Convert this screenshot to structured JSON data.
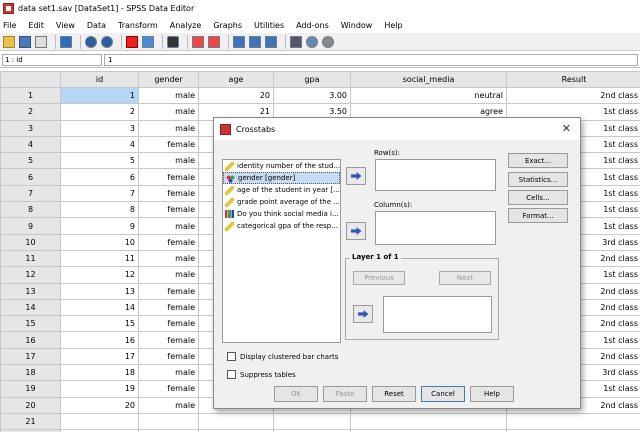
{
  "window": {
    "title": "data set1.sav [DataSet1] - SPSS Data Editor"
  },
  "menu": [
    "File",
    "Edit",
    "View",
    "Data",
    "Transform",
    "Analyze",
    "Graphs",
    "Utilities",
    "Add-ons",
    "Window",
    "Help"
  ],
  "toolbar": {
    "icons": [
      "open-folder-icon",
      "save-icon",
      "print-icon",
      "dialog-recall-icon",
      "undo-icon",
      "redo-icon",
      "go-to-case-icon",
      "variables-icon",
      "find-icon",
      "insert-cases-icon",
      "insert-variable-icon",
      "split-file-icon",
      "weight-cases-icon",
      "select-cases-icon",
      "value-labels-icon",
      "use-sets-icon",
      "show-all-variables-icon"
    ]
  },
  "cell_editor": {
    "reference": "1 : id",
    "value": "1"
  },
  "grid": {
    "columns": [
      "id",
      "gender",
      "age",
      "gpa",
      "social_media",
      "Result"
    ],
    "rows": [
      {
        "n": "1",
        "id": "1",
        "gender": "male",
        "age": "20",
        "gpa": "3.00",
        "social_media": "neutral",
        "result": "2nd class"
      },
      {
        "n": "2",
        "id": "2",
        "gender": "male",
        "age": "21",
        "gpa": "3.50",
        "social_media": "agree",
        "result": "1st class"
      },
      {
        "n": "3",
        "id": "3",
        "gender": "male",
        "age": "",
        "gpa": "",
        "social_media": "",
        "result": "1st class"
      },
      {
        "n": "4",
        "id": "4",
        "gender": "female",
        "age": "",
        "gpa": "",
        "social_media": "",
        "result": "1st class"
      },
      {
        "n": "5",
        "id": "5",
        "gender": "male",
        "age": "",
        "gpa": "",
        "social_media": "",
        "result": "1st class"
      },
      {
        "n": "6",
        "id": "6",
        "gender": "female",
        "age": "",
        "gpa": "",
        "social_media": "",
        "result": "1st class"
      },
      {
        "n": "7",
        "id": "7",
        "gender": "female",
        "age": "",
        "gpa": "",
        "social_media": "",
        "result": "1st class"
      },
      {
        "n": "8",
        "id": "8",
        "gender": "female",
        "age": "",
        "gpa": "",
        "social_media": "",
        "result": "1st class"
      },
      {
        "n": "9",
        "id": "9",
        "gender": "male",
        "age": "",
        "gpa": "",
        "social_media": "",
        "result": "1st class"
      },
      {
        "n": "10",
        "id": "10",
        "gender": "female",
        "age": "",
        "gpa": "",
        "social_media": "",
        "result": "3rd class"
      },
      {
        "n": "11",
        "id": "11",
        "gender": "male",
        "age": "",
        "gpa": "",
        "social_media": "",
        "result": "2nd class"
      },
      {
        "n": "12",
        "id": "12",
        "gender": "male",
        "age": "",
        "gpa": "",
        "social_media": "",
        "result": "1st class"
      },
      {
        "n": "13",
        "id": "13",
        "gender": "female",
        "age": "",
        "gpa": "",
        "social_media": "",
        "result": "2nd class"
      },
      {
        "n": "14",
        "id": "14",
        "gender": "female",
        "age": "",
        "gpa": "",
        "social_media": "",
        "result": "2nd class"
      },
      {
        "n": "15",
        "id": "15",
        "gender": "female",
        "age": "",
        "gpa": "",
        "social_media": "",
        "result": "2nd class"
      },
      {
        "n": "16",
        "id": "16",
        "gender": "female",
        "age": "",
        "gpa": "",
        "social_media": "",
        "result": "1st class"
      },
      {
        "n": "17",
        "id": "17",
        "gender": "female",
        "age": "",
        "gpa": "",
        "social_media": "",
        "result": "2nd class"
      },
      {
        "n": "18",
        "id": "18",
        "gender": "male",
        "age": "",
        "gpa": "",
        "social_media": "",
        "result": "3rd class"
      },
      {
        "n": "19",
        "id": "19",
        "gender": "female",
        "age": "",
        "gpa": "",
        "social_media": "",
        "result": "1st class"
      },
      {
        "n": "20",
        "id": "20",
        "gender": "male",
        "age": "",
        "gpa": "",
        "social_media": "",
        "result": "2nd class"
      },
      {
        "n": "21",
        "id": "",
        "gender": "",
        "age": "",
        "gpa": "",
        "social_media": "",
        "result": ""
      },
      {
        "n": "22",
        "id": "",
        "gender": "",
        "age": "",
        "gpa": "",
        "social_media": "",
        "result": ""
      }
    ]
  },
  "dialog": {
    "title": "Crosstabs",
    "close": "✕",
    "variables": [
      {
        "label": "identity number of the stud...",
        "icon": "ruler-icon"
      },
      {
        "label": "gender  [gender]",
        "icon": "nominal-icon",
        "selected": true
      },
      {
        "label": "age of the student in year [...",
        "icon": "ruler-icon"
      },
      {
        "label": "grade point average of the ...",
        "icon": "ruler-icon"
      },
      {
        "label": "Do you think social media i...",
        "icon": "ordinal-icon"
      },
      {
        "label": "categorical gpa of the resp...",
        "icon": "ruler-icon"
      }
    ],
    "rows_label": "Row(s):",
    "columns_label": "Column(s):",
    "layer_label": "Layer 1 of 1",
    "previous": "Previous",
    "next": "Next",
    "side_buttons": [
      "Exact...",
      "Statistics...",
      "Cells...",
      "Format..."
    ],
    "checkboxes": [
      "Display clustered bar charts",
      "Suppress tables"
    ],
    "bottom_buttons": [
      "OK",
      "Paste",
      "Reset",
      "Cancel",
      "Help"
    ]
  }
}
